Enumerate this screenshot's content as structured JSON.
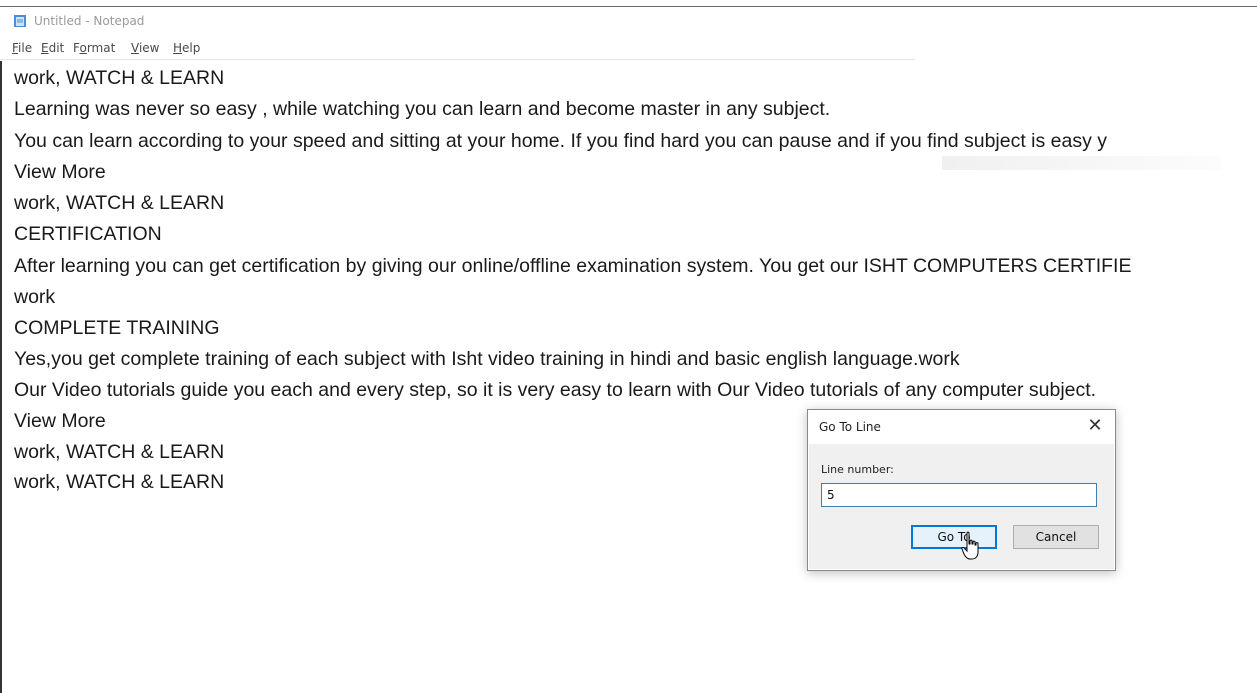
{
  "window": {
    "title": "Untitled - Notepad"
  },
  "menu": [
    {
      "label": "File",
      "accel": "F",
      "rest": "ile"
    },
    {
      "label": "Edit",
      "accel": "E",
      "rest": "dit"
    },
    {
      "label": "Format",
      "pre": "F",
      "accel": "o",
      "rest": "rmat"
    },
    {
      "label": "View",
      "accel": "V",
      "rest": "iew"
    },
    {
      "label": "Help",
      "accel": "H",
      "rest": "elp"
    }
  ],
  "document": {
    "lines": [
      "work, WATCH & LEARN",
      "Learning was never so easy , while watching you can learn and become master in any subject.",
      "You can learn according to your speed and sitting at your home. If you find hard you can pause and if you find subject is easy y",
      "View More",
      "work, WATCH & LEARN",
      "CERTIFICATION",
      "After learning you can get certification by giving our online/offline examination system. You get our ISHT COMPUTERS CERTIFIE",
      "work",
      "COMPLETE TRAINING",
      "Yes,you get complete training of each subject with Isht video training in hindi and basic english language.work",
      "Our Video tutorials guide you each and every step, so it is very easy to learn with Our Video tutorials of any computer subject.",
      "View More",
      "work, WATCH & LEARN",
      "work, WATCH & LEARN"
    ]
  },
  "dialog": {
    "title": "Go To Line",
    "close_glyph": "✕",
    "label": "Line number:",
    "input_value": "5",
    "goto_label": "Go To",
    "cancel_label": "Cancel"
  }
}
